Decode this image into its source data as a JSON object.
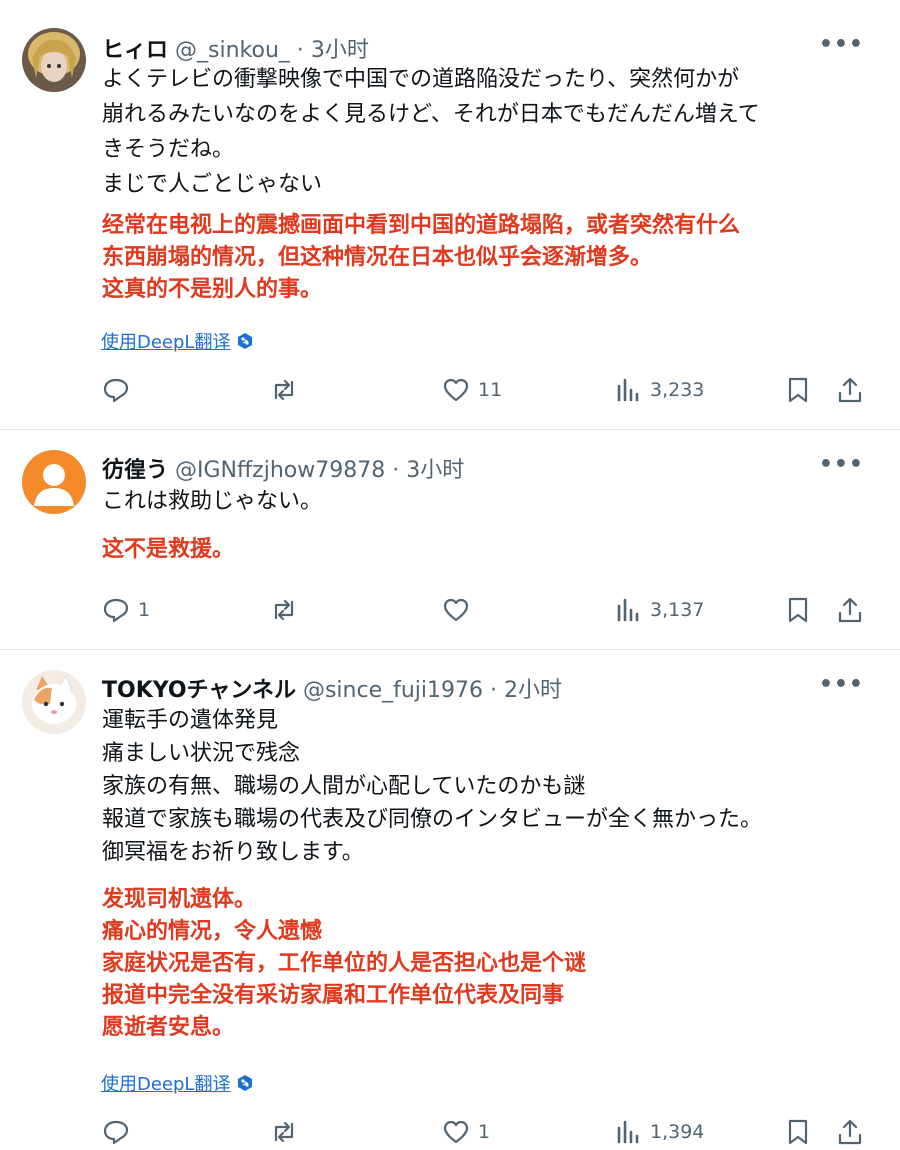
{
  "tweets": [
    {
      "name": "ヒィロ",
      "handle": "@_sinkou_",
      "time": "3小时",
      "jp_lines": [
        "よくテレビの衝撃映像で中国での道路陥没だったり、突然何かが",
        "崩れるみたいなのをよく見るけど、それが日本でもだんだん増えて",
        "きそうだね。",
        "まじで人ごとじゃない"
      ],
      "cn_lines": [
        "经常在电视上的震撼画面中看到中国的道路塌陷，或者突然有什么",
        "东西崩塌的情况，但这种情况在日本也似乎会逐渐增多。",
        "这真的不是别人的事。"
      ],
      "translate": "使用DeepL翻译",
      "reply_count": "",
      "like_count": "11",
      "views": "3,233"
    },
    {
      "name": "彷徨う",
      "handle": "@IGNffzjhow79878",
      "time": "3小时",
      "jp_lines": [
        "これは救助じゃない。"
      ],
      "cn_lines": [
        "这不是救援。"
      ],
      "translate": "",
      "reply_count": "1",
      "like_count": "",
      "views": "3,137"
    },
    {
      "name": "TOKYOチャンネル",
      "handle": "@since_fuji1976",
      "time": "2小时",
      "jp_lines": [
        "運転手の遺体発見",
        "痛ましい状況で残念",
        "家族の有無、職場の人間が心配していたのかも謎",
        "報道で家族も職場の代表及び同僚のインタビューが全く無かった。",
        "御冥福をお祈り致します。"
      ],
      "cn_lines": [
        "发现司机遗体。",
        "痛心的情况，令人遗憾",
        "家庭状况是否有，工作单位的人是否担心也是个谜",
        "报道中完全没有采访家属和工作单位代表及同事",
        "愿逝者安息。"
      ],
      "translate": "使用DeepL翻译",
      "reply_count": "",
      "like_count": "1",
      "views": "1,394"
    }
  ],
  "separator_dot": "·",
  "more_glyph": "•••",
  "colors": {
    "translation_red": "#e0391e",
    "link_blue": "#1d6fd6",
    "meta_gray": "#536471"
  }
}
